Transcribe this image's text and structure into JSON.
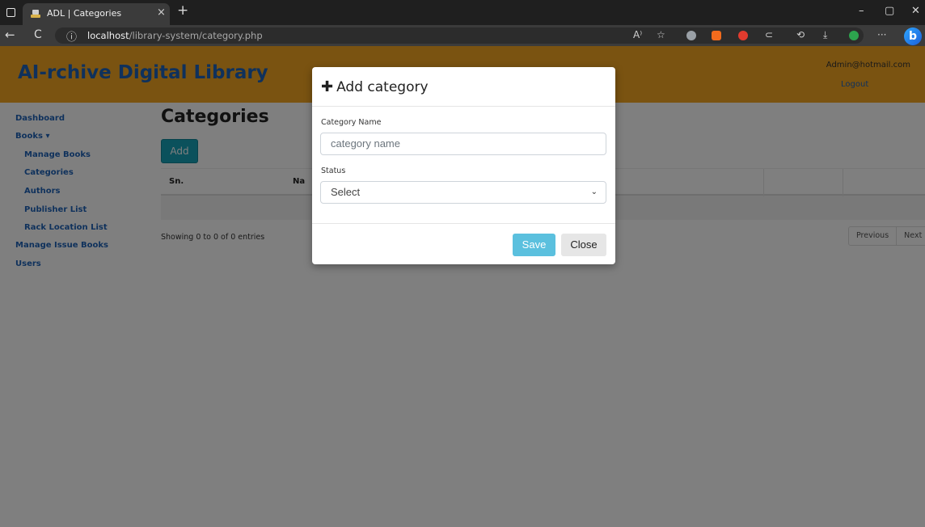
{
  "browser": {
    "tab_title": "ADL | Categories",
    "tab_close": "×",
    "new_tab": "+",
    "back_icon": "←",
    "reload_icon": "C",
    "info_icon": "ⓘ",
    "url_host": "localhost",
    "url_path": "/library-system/category.php",
    "read_aloud": "A⁾",
    "favorite_icon": "☆",
    "extensions_icon": "⊂",
    "history_icon": "⟲",
    "download_icon": "⤓",
    "more_icon": "···",
    "bing_label": "b",
    "minimize": "–",
    "restore": "▢",
    "close": "✕"
  },
  "header": {
    "brand": "AI-rchive Digital Library",
    "user_email": "Admin@hotmail.com",
    "logout": "Logout"
  },
  "sidebar": {
    "items": [
      {
        "label": "Dashboard"
      },
      {
        "label": "Books ▾"
      },
      {
        "label": "Manage Books"
      },
      {
        "label": "Categories"
      },
      {
        "label": "Authors"
      },
      {
        "label": "Publisher List"
      },
      {
        "label": "Rack Location List"
      },
      {
        "label": "Manage Issue Books"
      },
      {
        "label": "Users"
      }
    ]
  },
  "main": {
    "title": "Categories",
    "add_button": "Add",
    "table": {
      "headers": [
        "Sn.",
        "Na"
      ]
    },
    "showing": "Showing 0 to 0 of 0 entries",
    "pager": {
      "previous": "Previous",
      "next": "Next"
    }
  },
  "modal": {
    "plus": "✚",
    "title": "Add category",
    "name_label": "Category Name",
    "name_placeholder": "category name",
    "status_label": "Status",
    "status_value": "Select",
    "chevron": "⌄",
    "save": "Save",
    "close": "Close"
  },
  "colors": {
    "header_bg": "#f5a623",
    "brand": "#1e63b8",
    "add_button": "#17a2b8",
    "save_button": "#5bc0de"
  }
}
